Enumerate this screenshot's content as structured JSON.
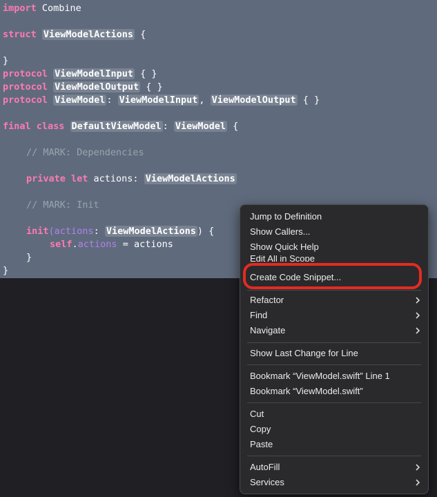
{
  "code": {
    "l1": {
      "kw": "import",
      "rest": " Combine"
    },
    "l3": {
      "kw": "struct",
      "type": "ViewModelActions",
      "rest": " {"
    },
    "l4": {
      "text": "}"
    },
    "l5": {
      "kw": "protocol",
      "type": "ViewModelInput",
      "rest": " { }"
    },
    "l6": {
      "kw": "protocol",
      "type": "ViewModelOutput",
      "rest": " { }"
    },
    "l7": {
      "kw": "protocol",
      "type": "ViewModel",
      "sep1": ": ",
      "type2": "ViewModelInput",
      "sep2": ", ",
      "type3": "ViewModelOutput",
      "rest": " { }"
    },
    "l9": {
      "kw": "final class",
      "type": "DefaultViewModel",
      "sep1": ": ",
      "type2": "ViewModel",
      "rest": " {"
    },
    "l11": {
      "comment": "// MARK: Dependencies"
    },
    "l13": {
      "kw": "private let",
      "name": " actions: ",
      "type": "ViewModelActions"
    },
    "l15": {
      "comment": "// MARK: Init"
    },
    "l17": {
      "kw": "init",
      "paren": "(",
      "param": "actions",
      "colon": ": ",
      "type": "ViewModelActions",
      "rest": ") {"
    },
    "l18": {
      "kw": "self",
      "dot": ".",
      "prop": "actions",
      "rest": " = actions"
    },
    "l19": {
      "text": "}"
    },
    "l20": {
      "text": "}"
    }
  },
  "context_menu": {
    "jump": "Jump to Definition",
    "callers": "Show Callers...",
    "quick_help": "Show Quick Help",
    "edit_all": "Edit All in Scope",
    "snippet": "Create Code Snippet...",
    "refactor": "Refactor",
    "find": "Find",
    "navigate": "Navigate",
    "last_change": "Show Last Change for Line",
    "bookmark_line": "Bookmark “ViewModel.swift” Line 1",
    "bookmark_file": "Bookmark “ViewModel.swift”",
    "cut": "Cut",
    "copy": "Copy",
    "paste": "Paste",
    "autofill": "AutoFill",
    "services": "Services"
  },
  "colors": {
    "keyword": "#ff7ab2",
    "comment": "#9aa3ae",
    "property": "#b281eb",
    "selection": "#5f6b7d",
    "highlight_ring": "#e42b22"
  },
  "icons": [
    "chevron-right-icon"
  ]
}
